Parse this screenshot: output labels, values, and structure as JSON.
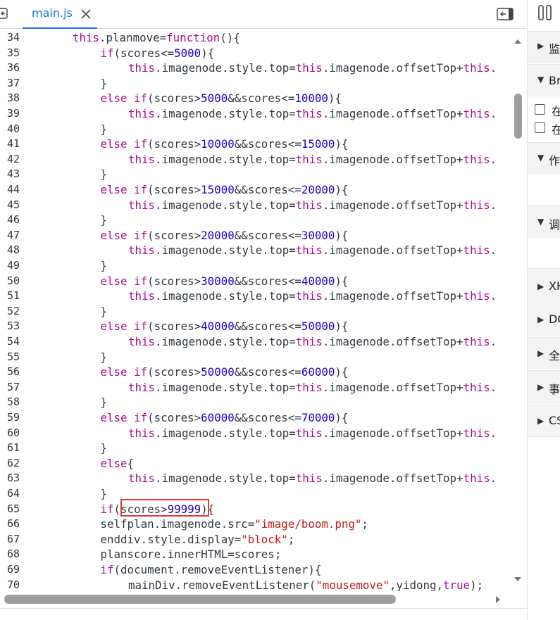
{
  "tabs": [
    {
      "label": "main.js"
    }
  ],
  "code": {
    "lines": [
      {
        "n": "34",
        "indent": 2,
        "tokens": [
          [
            "this",
            "kw"
          ],
          [
            ".planmove=",
            ""
          ],
          [
            "function",
            "kw"
          ],
          [
            "(){",
            ""
          ]
        ]
      },
      {
        "n": "35",
        "indent": 3,
        "tokens": [
          [
            "if",
            "kw"
          ],
          [
            "(scores<=",
            ""
          ],
          [
            "5000",
            "num"
          ],
          [
            "){",
            ""
          ]
        ]
      },
      {
        "n": "36",
        "indent": 4,
        "tokens": [
          [
            "this",
            "kw"
          ],
          [
            ".imagenode.style.top=",
            ""
          ],
          [
            "this",
            "kw"
          ],
          [
            ".imagenode.offsetTop+",
            ""
          ],
          [
            "this",
            "kw"
          ],
          [
            ".",
            ""
          ]
        ]
      },
      {
        "n": "37",
        "indent": 3,
        "tokens": [
          [
            "}",
            ""
          ]
        ]
      },
      {
        "n": "38",
        "indent": 3,
        "tokens": [
          [
            "else if",
            "kw"
          ],
          [
            "(scores>",
            ""
          ],
          [
            "5000",
            "num"
          ],
          [
            "&&scores<=",
            ""
          ],
          [
            "10000",
            "num"
          ],
          [
            "){",
            ""
          ]
        ]
      },
      {
        "n": "39",
        "indent": 4,
        "tokens": [
          [
            "this",
            "kw"
          ],
          [
            ".imagenode.style.top=",
            ""
          ],
          [
            "this",
            "kw"
          ],
          [
            ".imagenode.offsetTop+",
            ""
          ],
          [
            "this",
            "kw"
          ],
          [
            ".",
            ""
          ]
        ]
      },
      {
        "n": "40",
        "indent": 3,
        "tokens": [
          [
            "}",
            ""
          ]
        ]
      },
      {
        "n": "41",
        "indent": 3,
        "tokens": [
          [
            "else if",
            "kw"
          ],
          [
            "(scores>",
            ""
          ],
          [
            "10000",
            "num"
          ],
          [
            "&&scores<=",
            ""
          ],
          [
            "15000",
            "num"
          ],
          [
            "){",
            ""
          ]
        ]
      },
      {
        "n": "42",
        "indent": 4,
        "tokens": [
          [
            "this",
            "kw"
          ],
          [
            ".imagenode.style.top=",
            ""
          ],
          [
            "this",
            "kw"
          ],
          [
            ".imagenode.offsetTop+",
            ""
          ],
          [
            "this",
            "kw"
          ],
          [
            ".",
            ""
          ]
        ]
      },
      {
        "n": "43",
        "indent": 3,
        "tokens": [
          [
            "}",
            ""
          ]
        ]
      },
      {
        "n": "44",
        "indent": 3,
        "tokens": [
          [
            "else if",
            "kw"
          ],
          [
            "(scores>",
            ""
          ],
          [
            "15000",
            "num"
          ],
          [
            "&&scores<=",
            ""
          ],
          [
            "20000",
            "num"
          ],
          [
            "){",
            ""
          ]
        ]
      },
      {
        "n": "45",
        "indent": 4,
        "tokens": [
          [
            "this",
            "kw"
          ],
          [
            ".imagenode.style.top=",
            ""
          ],
          [
            "this",
            "kw"
          ],
          [
            ".imagenode.offsetTop+",
            ""
          ],
          [
            "this",
            "kw"
          ],
          [
            ".",
            ""
          ]
        ]
      },
      {
        "n": "46",
        "indent": 3,
        "tokens": [
          [
            "}",
            ""
          ]
        ]
      },
      {
        "n": "47",
        "indent": 3,
        "tokens": [
          [
            "else if",
            "kw"
          ],
          [
            "(scores>",
            ""
          ],
          [
            "20000",
            "num"
          ],
          [
            "&&scores<=",
            ""
          ],
          [
            "30000",
            "num"
          ],
          [
            "){",
            ""
          ]
        ]
      },
      {
        "n": "48",
        "indent": 4,
        "tokens": [
          [
            "this",
            "kw"
          ],
          [
            ".imagenode.style.top=",
            ""
          ],
          [
            "this",
            "kw"
          ],
          [
            ".imagenode.offsetTop+",
            ""
          ],
          [
            "this",
            "kw"
          ],
          [
            ".",
            ""
          ]
        ]
      },
      {
        "n": "49",
        "indent": 3,
        "tokens": [
          [
            "}",
            ""
          ]
        ]
      },
      {
        "n": "50",
        "indent": 3,
        "tokens": [
          [
            "else if",
            "kw"
          ],
          [
            "(scores>",
            ""
          ],
          [
            "30000",
            "num"
          ],
          [
            "&&scores<=",
            ""
          ],
          [
            "40000",
            "num"
          ],
          [
            "){",
            ""
          ]
        ]
      },
      {
        "n": "51",
        "indent": 4,
        "tokens": [
          [
            "this",
            "kw"
          ],
          [
            ".imagenode.style.top=",
            ""
          ],
          [
            "this",
            "kw"
          ],
          [
            ".imagenode.offsetTop+",
            ""
          ],
          [
            "this",
            "kw"
          ],
          [
            ".",
            ""
          ]
        ]
      },
      {
        "n": "52",
        "indent": 3,
        "tokens": [
          [
            "}",
            ""
          ]
        ]
      },
      {
        "n": "53",
        "indent": 3,
        "tokens": [
          [
            "else if",
            "kw"
          ],
          [
            "(scores>",
            ""
          ],
          [
            "40000",
            "num"
          ],
          [
            "&&scores<=",
            ""
          ],
          [
            "50000",
            "num"
          ],
          [
            "){",
            ""
          ]
        ]
      },
      {
        "n": "54",
        "indent": 4,
        "tokens": [
          [
            "this",
            "kw"
          ],
          [
            ".imagenode.style.top=",
            ""
          ],
          [
            "this",
            "kw"
          ],
          [
            ".imagenode.offsetTop+",
            ""
          ],
          [
            "this",
            "kw"
          ],
          [
            ".",
            ""
          ]
        ]
      },
      {
        "n": "55",
        "indent": 3,
        "tokens": [
          [
            "}",
            ""
          ]
        ]
      },
      {
        "n": "56",
        "indent": 3,
        "tokens": [
          [
            "else if",
            "kw"
          ],
          [
            "(scores>",
            ""
          ],
          [
            "50000",
            "num"
          ],
          [
            "&&scores<=",
            ""
          ],
          [
            "60000",
            "num"
          ],
          [
            "){",
            ""
          ]
        ]
      },
      {
        "n": "57",
        "indent": 4,
        "tokens": [
          [
            "this",
            "kw"
          ],
          [
            ".imagenode.style.top=",
            ""
          ],
          [
            "this",
            "kw"
          ],
          [
            ".imagenode.offsetTop+",
            ""
          ],
          [
            "this",
            "kw"
          ],
          [
            ".",
            ""
          ]
        ]
      },
      {
        "n": "58",
        "indent": 3,
        "tokens": [
          [
            "}",
            ""
          ]
        ]
      },
      {
        "n": "59",
        "indent": 3,
        "tokens": [
          [
            "else if",
            "kw"
          ],
          [
            "(scores>",
            ""
          ],
          [
            "60000",
            "num"
          ],
          [
            "&&scores<=",
            ""
          ],
          [
            "70000",
            "num"
          ],
          [
            "){",
            ""
          ]
        ]
      },
      {
        "n": "60",
        "indent": 4,
        "tokens": [
          [
            "this",
            "kw"
          ],
          [
            ".imagenode.style.top=",
            ""
          ],
          [
            "this",
            "kw"
          ],
          [
            ".imagenode.offsetTop+",
            ""
          ],
          [
            "this",
            "kw"
          ],
          [
            ".",
            ""
          ]
        ]
      },
      {
        "n": "61",
        "indent": 3,
        "tokens": [
          [
            "}",
            ""
          ]
        ]
      },
      {
        "n": "62",
        "indent": 3,
        "tokens": [
          [
            "else",
            "kw"
          ],
          [
            "{",
            ""
          ]
        ]
      },
      {
        "n": "63",
        "indent": 4,
        "tokens": [
          [
            "this",
            "kw"
          ],
          [
            ".imagenode.style.top=",
            ""
          ],
          [
            "this",
            "kw"
          ],
          [
            ".imagenode.offsetTop+",
            ""
          ],
          [
            "this",
            "kw"
          ],
          [
            ".",
            ""
          ]
        ]
      },
      {
        "n": "64",
        "indent": 3,
        "tokens": [
          [
            "}",
            ""
          ]
        ]
      },
      {
        "n": "65",
        "indent": 3,
        "tokens": [
          [
            "if",
            "kw"
          ],
          [
            "(scores>",
            ""
          ],
          [
            "99999",
            "num"
          ],
          [
            "){",
            ""
          ]
        ]
      },
      {
        "n": "66",
        "indent": 3,
        "tokens": [
          [
            "selfplan.imagenode.src=",
            ""
          ],
          [
            "\"image/boom.png\"",
            "str"
          ],
          [
            ";",
            ""
          ]
        ]
      },
      {
        "n": "67",
        "indent": 3,
        "tokens": [
          [
            "enddiv.style.display=",
            ""
          ],
          [
            "\"block\"",
            "str"
          ],
          [
            ";",
            ""
          ]
        ]
      },
      {
        "n": "68",
        "indent": 3,
        "tokens": [
          [
            "planscore.innerHTML=scores;",
            ""
          ]
        ]
      },
      {
        "n": "69",
        "indent": 3,
        "tokens": [
          [
            "if",
            "kw"
          ],
          [
            "(document.removeEventListener){",
            ""
          ]
        ]
      },
      {
        "n": "70",
        "indent": 4,
        "tokens": [
          [
            "mainDiv.removeEventListener(",
            ""
          ],
          [
            "\"mousemove\"",
            "str"
          ],
          [
            ",yidong,",
            ""
          ],
          [
            "true",
            "kw"
          ],
          [
            ");",
            ""
          ]
        ]
      }
    ]
  },
  "sidebar": {
    "panels": [
      {
        "arrow": "▶",
        "label": "监"
      },
      {
        "arrow": "▼",
        "label": "Br"
      },
      {
        "arrow": "▼",
        "label": "作"
      },
      {
        "arrow": "▼",
        "label": "调"
      },
      {
        "arrow": "▶",
        "label": "XH"
      },
      {
        "arrow": "▶",
        "label": "DC"
      },
      {
        "arrow": "▶",
        "label": "全"
      },
      {
        "arrow": "▶",
        "label": "事"
      },
      {
        "arrow": "▶",
        "label": "CS"
      }
    ],
    "checkboxes": [
      {
        "label": "在",
        "checked": false
      },
      {
        "label": "在",
        "checked": false
      }
    ]
  },
  "colors": {
    "keyword": "#aa0d91",
    "number": "#1c00cf",
    "string": "#c41a16",
    "accent": "#1a73e8",
    "highlight": "#e53935"
  }
}
